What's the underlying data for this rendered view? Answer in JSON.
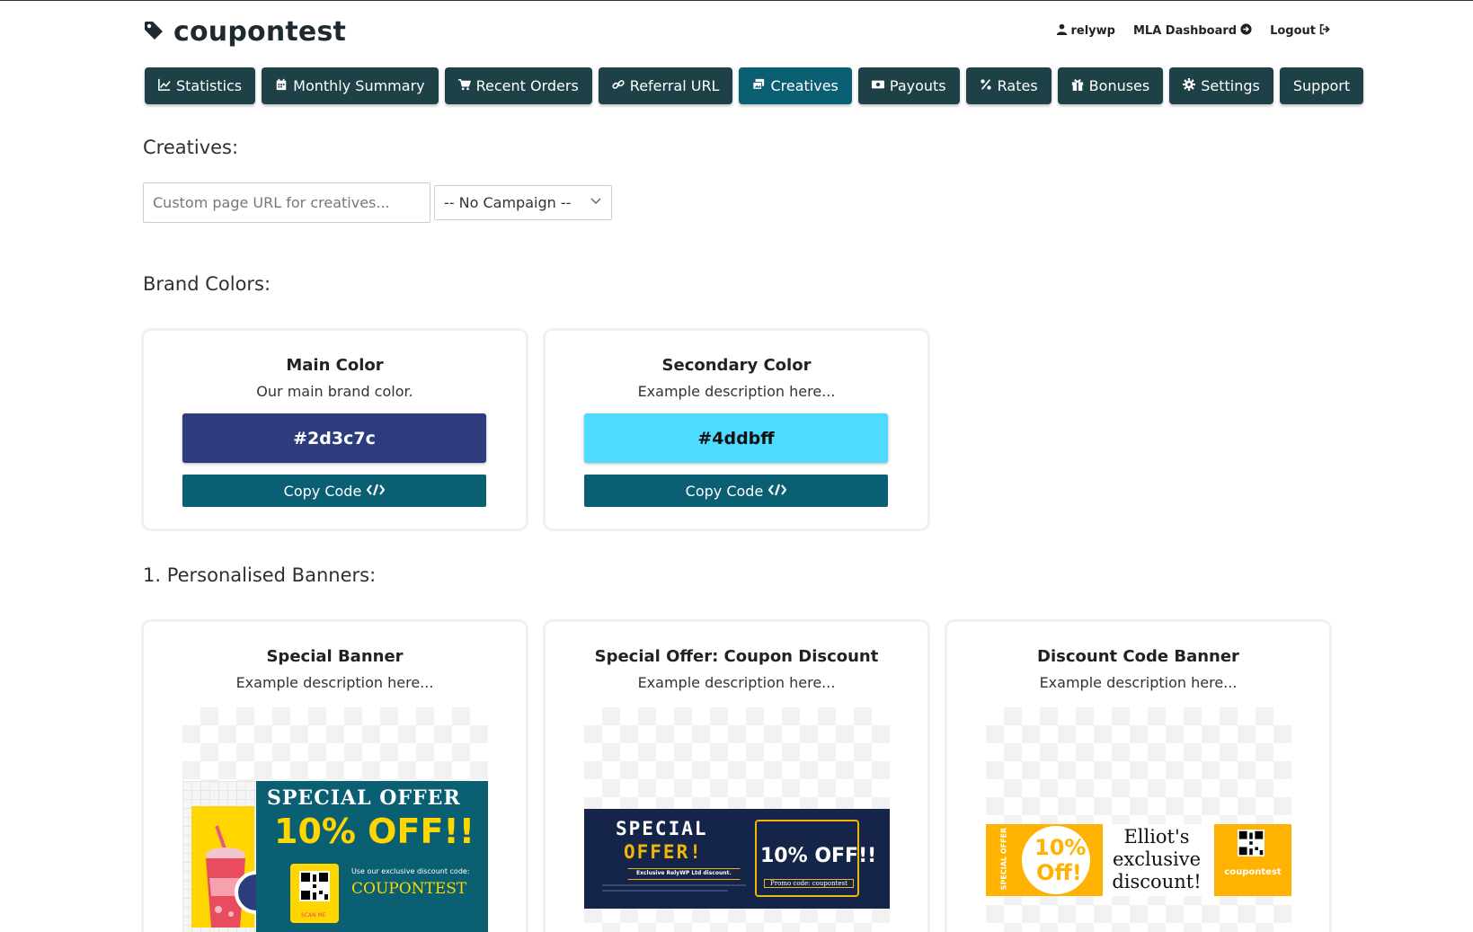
{
  "header": {
    "brand": "coupontest",
    "user": "relywp",
    "dashboard": "MLA Dashboard",
    "logout": "Logout"
  },
  "nav": [
    {
      "label": "Statistics",
      "icon": "chart-line-icon"
    },
    {
      "label": "Monthly Summary",
      "icon": "calendar-icon"
    },
    {
      "label": "Recent Orders",
      "icon": "cart-icon"
    },
    {
      "label": "Referral URL",
      "icon": "link-icon"
    },
    {
      "label": "Creatives",
      "icon": "images-icon",
      "active": true
    },
    {
      "label": "Payouts",
      "icon": "money-icon"
    },
    {
      "label": "Rates",
      "icon": "percent-icon"
    },
    {
      "label": "Bonuses",
      "icon": "gift-icon"
    },
    {
      "label": "Settings",
      "icon": "gear-icon"
    },
    {
      "label": "Support"
    }
  ],
  "creatives": {
    "title": "Creatives:",
    "url_placeholder": "Custom page URL for creatives...",
    "campaign_selected": "-- No Campaign --"
  },
  "brand_colors": {
    "title": "Brand Colors:",
    "copy_label": "Copy Code",
    "cards": [
      {
        "title": "Main Color",
        "desc": "Our main brand color.",
        "hex": "#2d3c7c",
        "text_color": "#ffffff"
      },
      {
        "title": "Secondary Color",
        "desc": "Example description here...",
        "hex": "#4ddbff",
        "text_color": "#111111"
      }
    ]
  },
  "banners": {
    "title": "1. Personalised Banners:",
    "cards": [
      {
        "title": "Special Banner",
        "desc": "Example description here..."
      },
      {
        "title": "Special Offer: Coupon Discount",
        "desc": "Example description here..."
      },
      {
        "title": "Discount Code Banner",
        "desc": "Example description here..."
      }
    ]
  },
  "banner1": {
    "headline": "SPECIAL OFFER",
    "discount": "10% OFF!!",
    "use_text": "Use our exclusive discount code:",
    "code": "COUPONTEST",
    "scan": "SCAN ME"
  },
  "banner2": {
    "line1": "SPECIAL",
    "line2": "OFFER!",
    "exclusive": "Exclusive RelyWP Ltd discount.",
    "discount": "10% OFF!!",
    "promo": "Promo code: coupontest"
  },
  "banner3": {
    "side": "SPECIAL OFFER",
    "pct": "10%",
    "off": "Off!",
    "line1": "Elliot's",
    "line2": "exclusive",
    "line3": "discount!",
    "code": "coupontest"
  },
  "colors": {
    "nav_bg": "#1e4047",
    "nav_active": "#0b5f73",
    "copy_btn": "#0b5f73"
  }
}
